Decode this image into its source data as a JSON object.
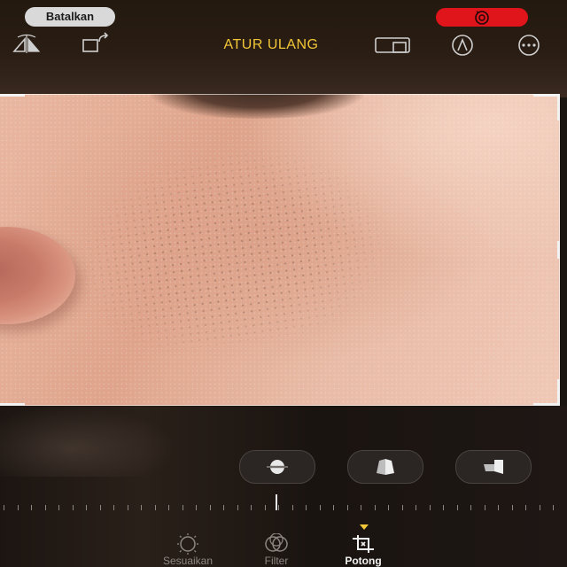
{
  "header": {
    "cancel_label": "Batalkan",
    "reset_label": "ATUR ULANG",
    "accent_color": "#f3c737",
    "live_color": "#e0141b"
  },
  "toolbar_icons": {
    "left": [
      "flip-vertical-icon",
      "rotate-icon"
    ],
    "right": [
      "aspect-ratio-icon",
      "markup-icon",
      "more-icon"
    ]
  },
  "crop_tools": [
    "straighten-icon",
    "vertical-perspective-icon",
    "horizontal-perspective-icon"
  ],
  "bottom_tabs": [
    {
      "label": "Sesuaikan",
      "icon": "adjust-icon"
    },
    {
      "label": "Filter",
      "icon": "filter-icon"
    },
    {
      "label": "Potong",
      "icon": "crop-icon",
      "active": true
    }
  ]
}
